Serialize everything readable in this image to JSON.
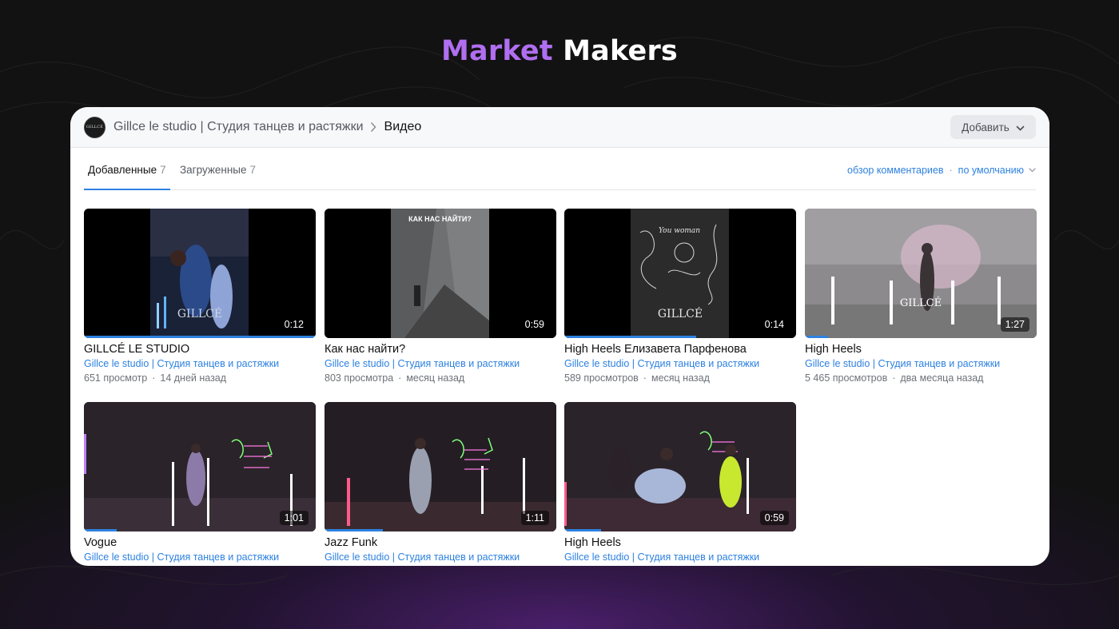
{
  "brand": {
    "part1": "Market",
    "part2": "Makers"
  },
  "header": {
    "avatar_text": "GILLCÉ",
    "group_name": "Gillce le studio | Студия танцев и растяжки",
    "current_section": "Видео",
    "add_button": "Добавить"
  },
  "tabs": [
    {
      "label": "Добавленные",
      "count": "7",
      "active": true
    },
    {
      "label": "Загруженные",
      "count": "7",
      "active": false
    }
  ],
  "sort": {
    "comments_label": "обзор комментариев",
    "order_label": "по умолчанию"
  },
  "videos": [
    {
      "title": "GILLCÉ LE STUDIO",
      "channel": "Gillce le studio | Студия танцев и растяжки",
      "views": "651 просмотр",
      "age": "14 дней назад",
      "duration": "0:12",
      "progress": 1.0
    },
    {
      "title": "Как нас найти?",
      "channel": "Gillce le studio | Студия танцев и растяжки",
      "views": "803 просмотра",
      "age": "месяц назад",
      "duration": "0:59",
      "progress": 0.0,
      "overlay_text": "КАК НАС НАЙТИ?"
    },
    {
      "title": "High Heels Елизавета Парфенова",
      "channel": "Gillce le studio | Студия танцев и растяжки",
      "views": "589 просмотров",
      "age": "месяц назад",
      "duration": "0:14",
      "progress": 0.57
    },
    {
      "title": "High Heels",
      "channel": "Gillce le studio | Студия танцев и растяжки",
      "views": "5 465 просмотров",
      "age": "два месяца назад",
      "duration": "1:27",
      "progress": 0.1
    },
    {
      "title": "Vogue",
      "channel": "Gillce le studio | Студия танцев и растяжки",
      "duration": "1:01",
      "progress": 0.14
    },
    {
      "title": "Jazz Funk",
      "channel": "Gillce le studio | Студия танцев и растяжки",
      "duration": "1:11",
      "progress": 0.25
    },
    {
      "title": "High Heels",
      "channel": "Gillce le studio | Студия танцев и растяжки",
      "duration": "0:59",
      "progress": 0.16
    }
  ],
  "colors": {
    "accent": "#2d81e0",
    "brand_purple": "#b06ef0"
  },
  "icons": {
    "breadcrumb_separator": "chevron-right-icon",
    "add_dropdown": "chevron-down-icon",
    "sort_dropdown": "chevron-down-icon"
  }
}
